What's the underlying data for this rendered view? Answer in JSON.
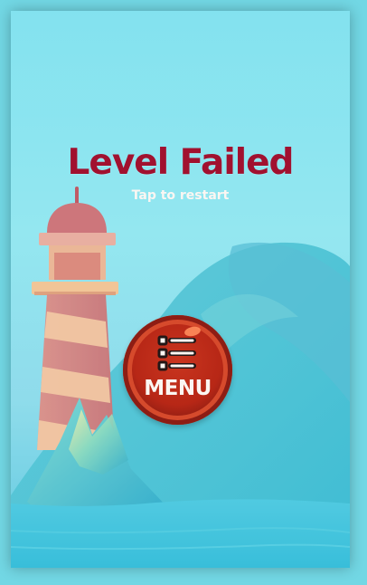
{
  "screen": {
    "title": "Level Failed",
    "subtitle": "Tap to restart",
    "menu_button": {
      "label": "MENU",
      "icon": "menu-list-icon"
    },
    "colors": {
      "title": "#a1112f",
      "button_red": "#b72716",
      "text_light": "#fbf6f2",
      "sky": "#79e0ee"
    }
  }
}
